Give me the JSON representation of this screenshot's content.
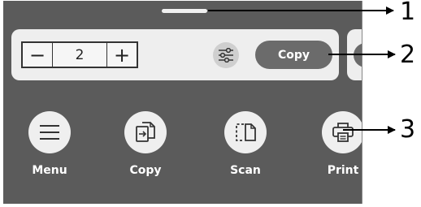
{
  "copy_card": {
    "decrement_symbol": "−",
    "quantity": "2",
    "increment_symbol": "+",
    "settings_icon": "sliders-icon",
    "copy_button_label": "Copy"
  },
  "apps": [
    {
      "label": "Menu",
      "icon": "menu-icon"
    },
    {
      "label": "Copy",
      "icon": "copy-icon"
    },
    {
      "label": "Scan",
      "icon": "scan-icon"
    },
    {
      "label": "Print",
      "icon": "print-icon"
    }
  ],
  "callouts": [
    "1",
    "2",
    "3"
  ],
  "colors": {
    "screen_background": "#5b5b5b",
    "card_background": "#eeeeee",
    "copy_button": "#6b6b6b",
    "app_circle": "#efefef"
  }
}
